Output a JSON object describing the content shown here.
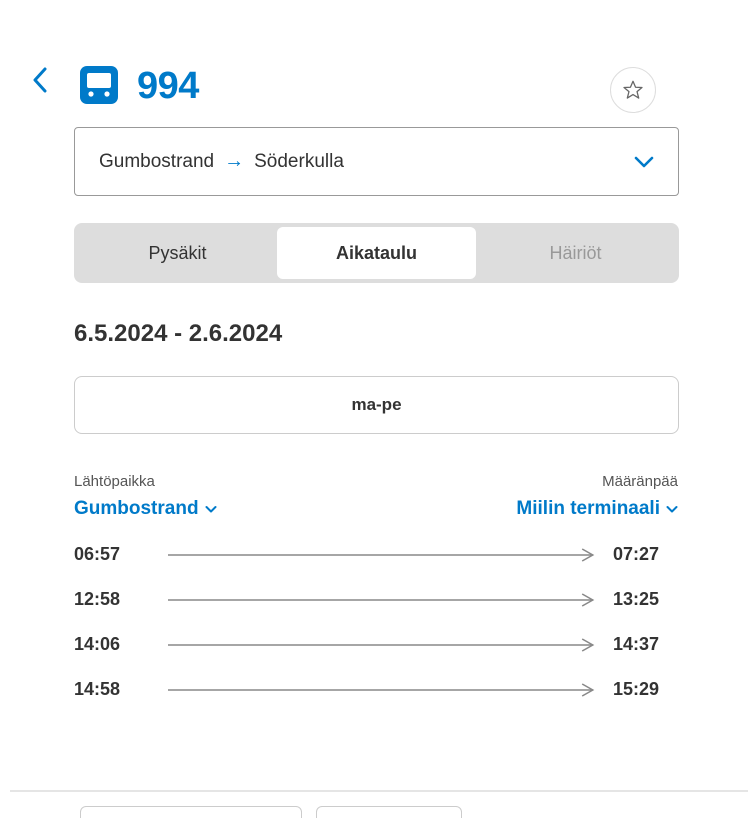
{
  "header": {
    "route_number": "994",
    "back_icon": "chevron-left-icon",
    "bus_icon": "bus-icon",
    "favourite_icon": "star-outline-icon"
  },
  "direction": {
    "from": "Gumbostrand",
    "arrow": "→",
    "to": "Söderkulla"
  },
  "tabs": [
    {
      "label": "Pysäkit",
      "state": "inactive"
    },
    {
      "label": "Aikataulu",
      "state": "active"
    },
    {
      "label": "Häiriöt",
      "state": "disabled"
    }
  ],
  "schedule": {
    "date_range": "6.5.2024 - 2.6.2024",
    "day_selector": "ma-pe",
    "departure_label": "Lähtöpaikka",
    "departure_stop": "Gumbostrand",
    "destination_label": "Määränpää",
    "destination_stop": "Miilin terminaali",
    "trips": [
      {
        "depart": "06:57",
        "arrive": "07:27"
      },
      {
        "depart": "12:58",
        "arrive": "13:25"
      },
      {
        "depart": "14:06",
        "arrive": "14:37"
      },
      {
        "depart": "14:58",
        "arrive": "15:29"
      }
    ]
  },
  "colors": {
    "accent": "#007ac9",
    "text": "#333333",
    "tab_bg": "#dddddd",
    "disabled": "#999999"
  }
}
